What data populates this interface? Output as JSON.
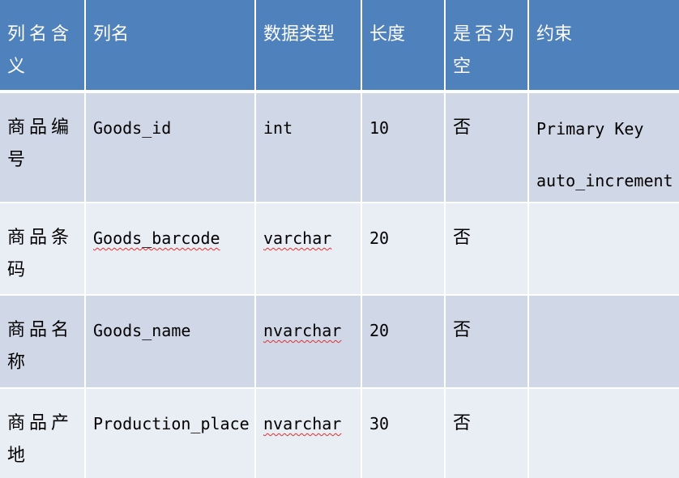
{
  "headers": [
    "列名含义",
    "列名",
    "数据类型",
    "长度",
    "是否为空",
    "约束"
  ],
  "rows": [
    {
      "meaning": "商品编号",
      "column": "Goods_id",
      "type": "int",
      "length": "10",
      "nullable": "否",
      "constraint": [
        "Primary Key",
        "auto_increment"
      ]
    },
    {
      "meaning": "商品条码",
      "column": "Goods_barcode",
      "type": "varchar",
      "length": "20",
      "nullable": "否",
      "constraint": []
    },
    {
      "meaning": "商品名称",
      "column": "Goods_name",
      "type": "nvarchar",
      "length": "20",
      "nullable": "否",
      "constraint": []
    },
    {
      "meaning": "商品产地",
      "column": "Production_place",
      "type": "nvarchar",
      "length": "30",
      "nullable": "否",
      "constraint": []
    }
  ],
  "colors": {
    "header_bg": "#4f81bd",
    "row_odd": "#d0d8e8",
    "row_even": "#e9edf4",
    "spellcheck": "#e03030"
  }
}
